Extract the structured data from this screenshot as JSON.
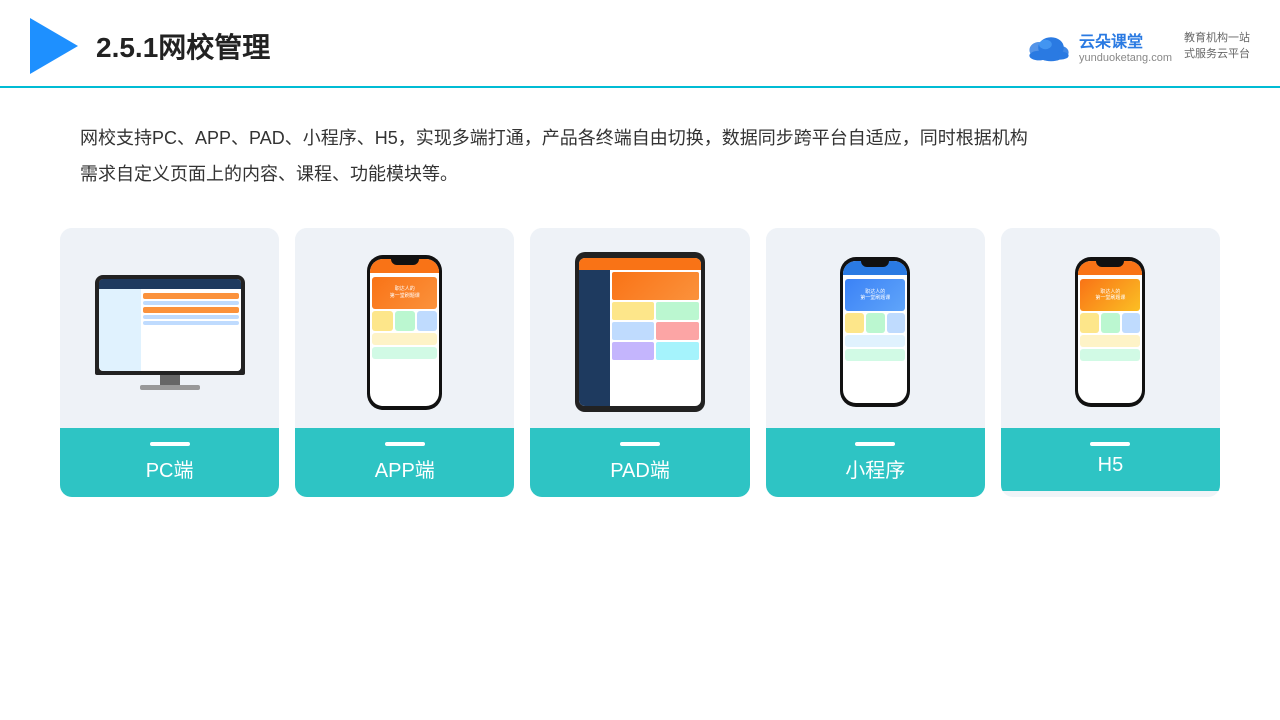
{
  "header": {
    "title": "2.5.1网校管理",
    "brand": {
      "name": "云朵课堂",
      "url": "yunduoketang.com",
      "slogan": "教育机构一站\n式服务云平台"
    }
  },
  "description": {
    "text": "网校支持PC、APP、PAD、小程序、H5，实现多端打通，产品各终端自由切换，数据同步跨平台自适应，同时根据机构\n需求自定义页面上的内容、课程、功能模块等。"
  },
  "cards": [
    {
      "id": "pc",
      "label": "PC端",
      "type": "pc"
    },
    {
      "id": "app",
      "label": "APP端",
      "type": "phone"
    },
    {
      "id": "pad",
      "label": "PAD端",
      "type": "tablet"
    },
    {
      "id": "miniprogram",
      "label": "小程序",
      "type": "phone2"
    },
    {
      "id": "h5",
      "label": "H5",
      "type": "phone3"
    }
  ]
}
